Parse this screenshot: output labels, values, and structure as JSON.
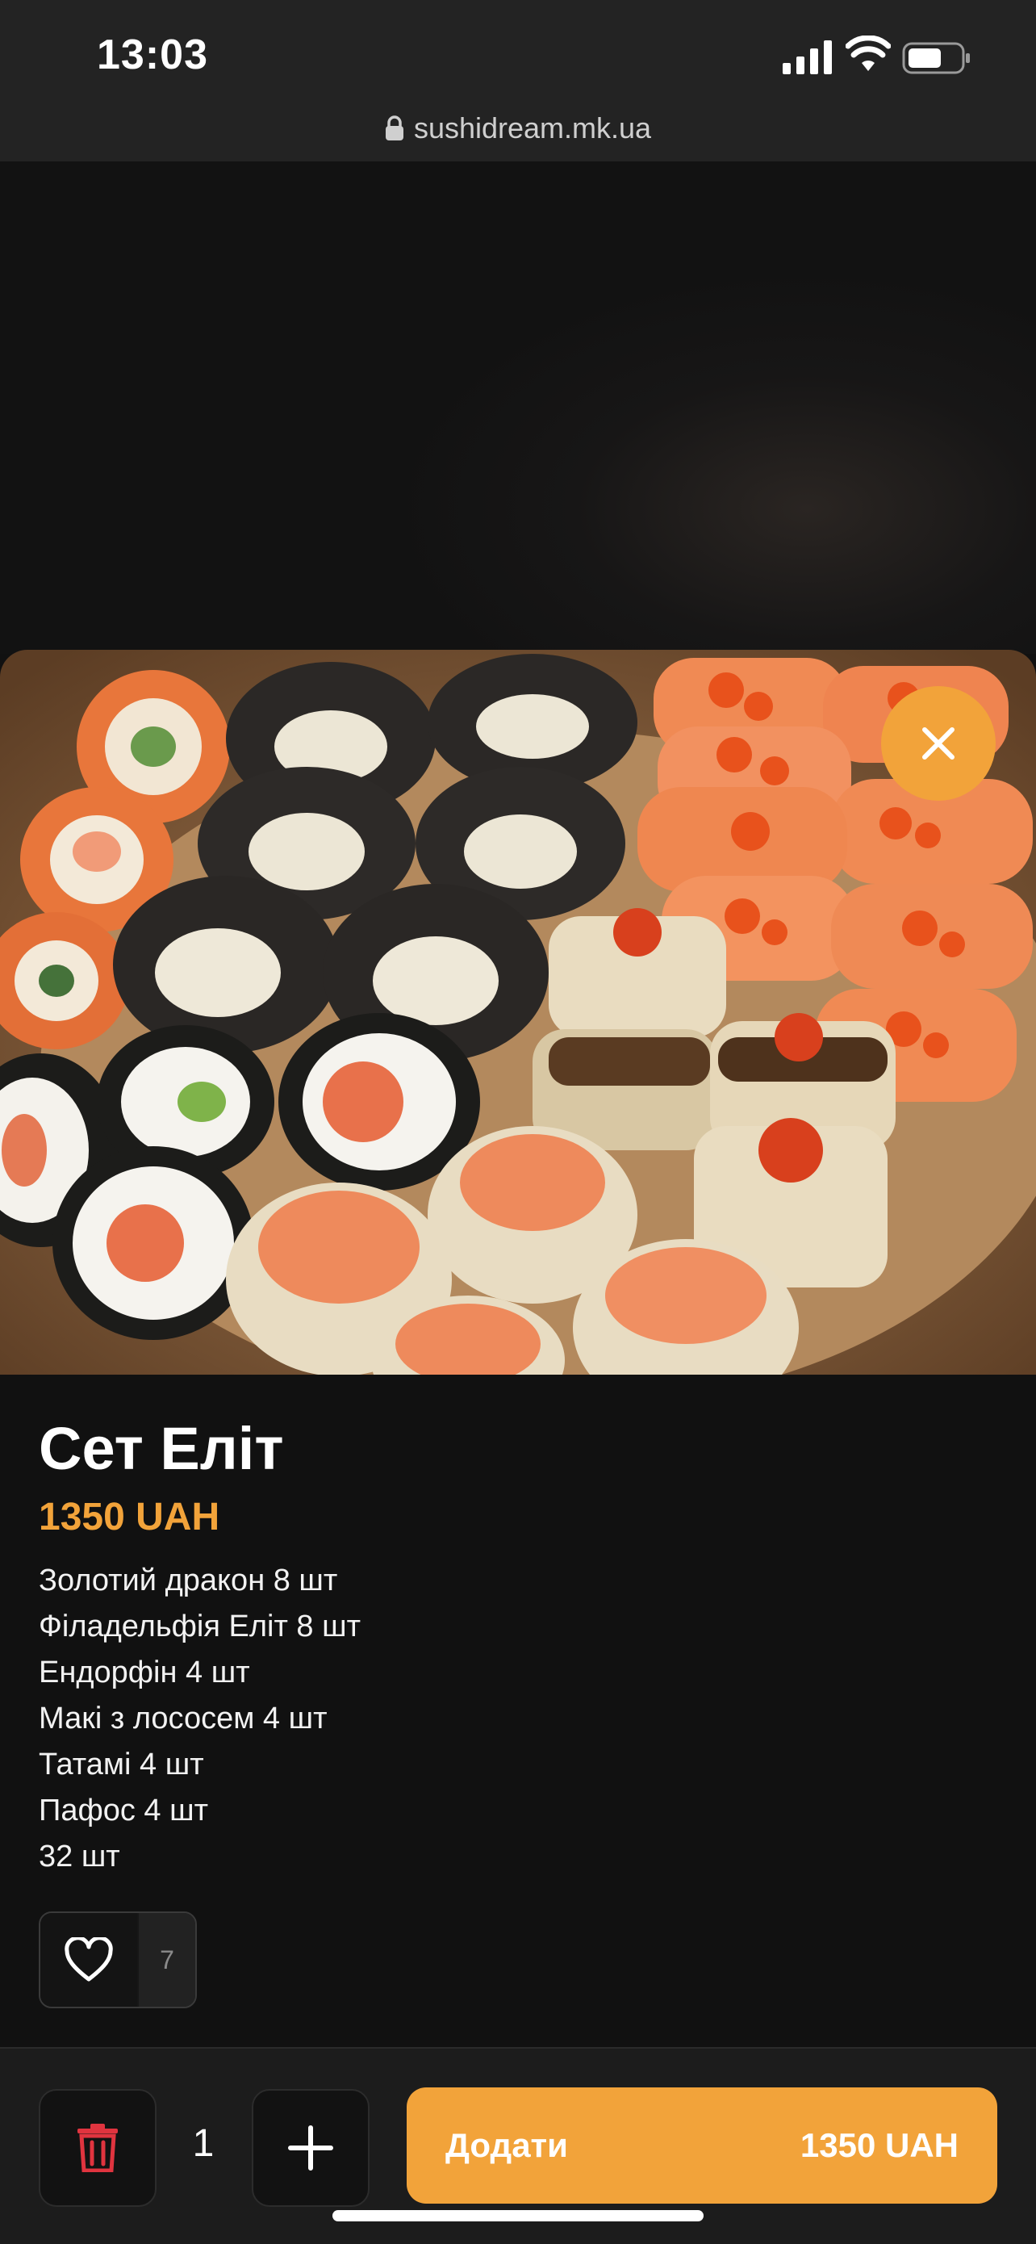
{
  "status_bar": {
    "time": "13:03",
    "icons": [
      "signal-icon",
      "wifi-icon",
      "battery-icon"
    ]
  },
  "browser": {
    "url": "sushidream.mk.ua",
    "icon": "lock-icon"
  },
  "product": {
    "title": "Сет Еліт",
    "price": "1350 UAH",
    "composition": [
      "Золотий дракон 8 шт",
      "Філадельфія Еліт 8 шт",
      "Ендорфін 4 шт",
      "Макі з лососем 4 шт",
      "Татамі 4 шт",
      "Пафос 4 шт",
      "32 шт"
    ],
    "favorites_count": "7",
    "image_icon": "sushi-set-photo"
  },
  "cart": {
    "quantity": "1",
    "add_label": "Додати",
    "add_price": "1350 UAH",
    "icons": [
      "trash-icon",
      "plus-icon",
      "close-icon",
      "heart-icon"
    ]
  },
  "colors": {
    "accent": "#f2a33a",
    "background": "#111111",
    "danger": "#e0343f"
  }
}
